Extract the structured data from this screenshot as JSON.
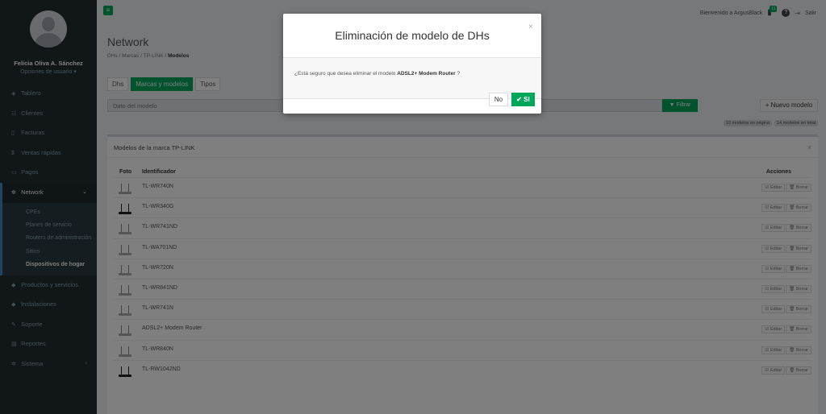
{
  "user": {
    "name": "Felicia Oliva A. Sánchez",
    "options": "Opciones de usuario ▾"
  },
  "sidebar": {
    "items": [
      {
        "icon": "dashboard-icon",
        "glyph": "◈",
        "label": "Tablero"
      },
      {
        "icon": "users-icon",
        "glyph": "☷",
        "label": "Clientes"
      },
      {
        "icon": "file-icon",
        "glyph": "▯",
        "label": "Facturas"
      },
      {
        "icon": "dollar-icon",
        "glyph": "$",
        "label": "Ventas rápidas"
      },
      {
        "icon": "card-icon",
        "glyph": "▭",
        "label": "Pagos"
      }
    ],
    "network": {
      "glyph": "✲",
      "label": "Network",
      "arrow": "⌄"
    },
    "network_sub": [
      "CPEs",
      "Planes de servicio",
      "Routers de administración",
      "Sitios",
      "Dispositivos de hogar"
    ],
    "bottom_items": [
      {
        "icon": "tag-icon",
        "glyph": "◆",
        "label": "Productos y servicios"
      },
      {
        "icon": "bolt-icon",
        "glyph": "◆",
        "label": "Instalaciones"
      },
      {
        "icon": "wrench-icon",
        "glyph": "✎",
        "label": "Soporte"
      },
      {
        "icon": "chart-icon",
        "glyph": "▤",
        "label": "Reportes"
      },
      {
        "icon": "cogs-icon",
        "glyph": "✲",
        "label": "Sistema",
        "arrow": "‹"
      }
    ]
  },
  "topbar": {
    "toggle_glyph": "≡",
    "welcome": "Bienvenido a ArgusBlack",
    "notif_count": "11",
    "help": "?",
    "logout_glyph": "⇥",
    "logout": "Salir"
  },
  "page": {
    "title": "Network",
    "breadcrumb": {
      "b1": "DHs",
      "sep": "/",
      "b2": "Marcas",
      "b3": "TP-LINK",
      "b4": "Modelos"
    },
    "tabs": [
      "Dhs",
      "Marcas y modelos",
      "Tipos"
    ],
    "search_placeholder": "Dato del modelo",
    "filter_label": "▼ Filtrar",
    "new_label": "+ Nuevo modelo",
    "count_page": "10 modelos en página",
    "count_total": "14 modelos en total"
  },
  "panel": {
    "title": "Modelos de la marca TP-LINK",
    "close": "×",
    "headers": {
      "foto": "Foto",
      "id": "Identificador",
      "acciones": "Acciones"
    },
    "edit_label": "☑ Editar",
    "delete_label": "🗑 Borrar",
    "rows": [
      "TL-WR740N",
      "TL-WR340G",
      "TL-WR741ND",
      "TL-WA701ND",
      "TL-WR720N",
      "TL-WR841ND",
      "TL-WR741N",
      "ADSL2+ Modem Router",
      "TL-WR840N",
      "TL-RW1042ND"
    ]
  },
  "modal": {
    "title": "Eliminación de modelo de DHs",
    "close": "×",
    "msg_pre": "¿Está seguro que desea eliminar el modelo",
    "msg_model": "ADSL2+ Modem Router",
    "msg_post": "?",
    "no_label": "No",
    "si_label": "✔ SI"
  }
}
